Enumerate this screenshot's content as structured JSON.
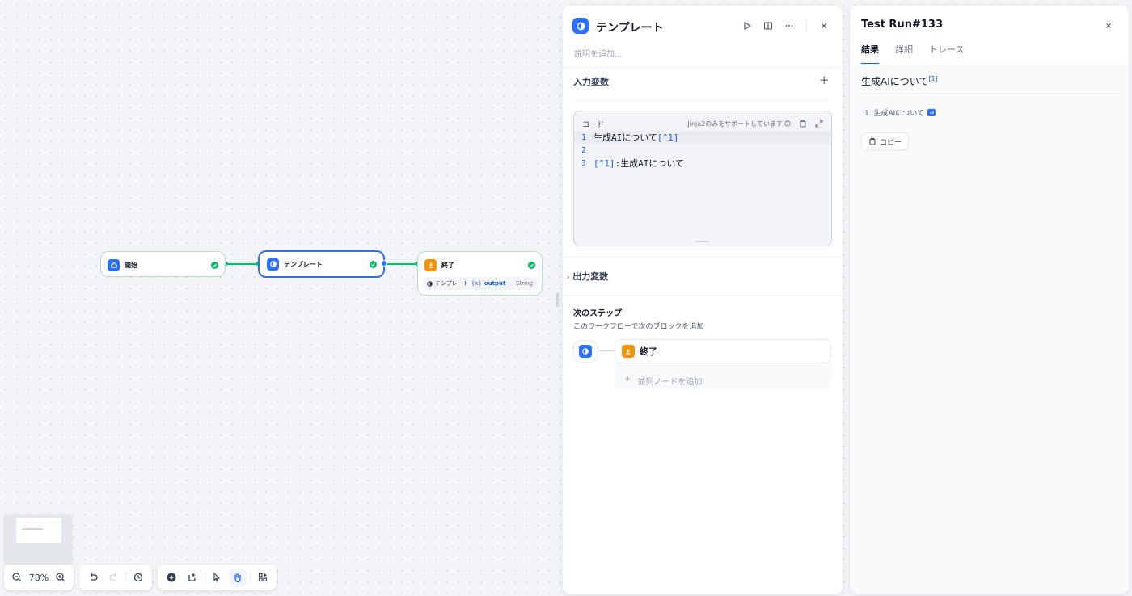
{
  "canvas": {
    "nodes": {
      "start": {
        "title": "開始"
      },
      "template": {
        "title": "テンプレート"
      },
      "end": {
        "title": "終了",
        "var_source": "テンプレート",
        "var_badge": "{x}",
        "var_name": "output",
        "var_type": "String"
      }
    },
    "toolbar": {
      "zoom": "78%"
    }
  },
  "template_panel": {
    "title": "テンプレート",
    "description_placeholder": "説明を追加...",
    "input_vars_title": "入力変数",
    "code": {
      "label": "コード",
      "hint": "Jinja2のみをサポートしています",
      "lines": [
        {
          "num": "1",
          "text": "生成AIについて",
          "ref": "[^1]"
        },
        {
          "num": "2",
          "text": "",
          "ref": ""
        },
        {
          "num": "3",
          "ref": "[^1]",
          "text": ":生成AIについて"
        }
      ]
    },
    "output_vars_title": "出力変数",
    "next_step": {
      "title": "次のステップ",
      "description": "このワークフローで次のブロックを追加",
      "item": "終了",
      "add_parallel": "並列ノードを追加"
    }
  },
  "run_panel": {
    "title": "Test Run#133",
    "tabs": [
      "結果",
      "詳細",
      "トレース"
    ],
    "result": {
      "heading": "生成AIについて",
      "sup": "[1]",
      "footnote": "1. 生成AIについて",
      "copy_label": "コピー"
    }
  }
}
